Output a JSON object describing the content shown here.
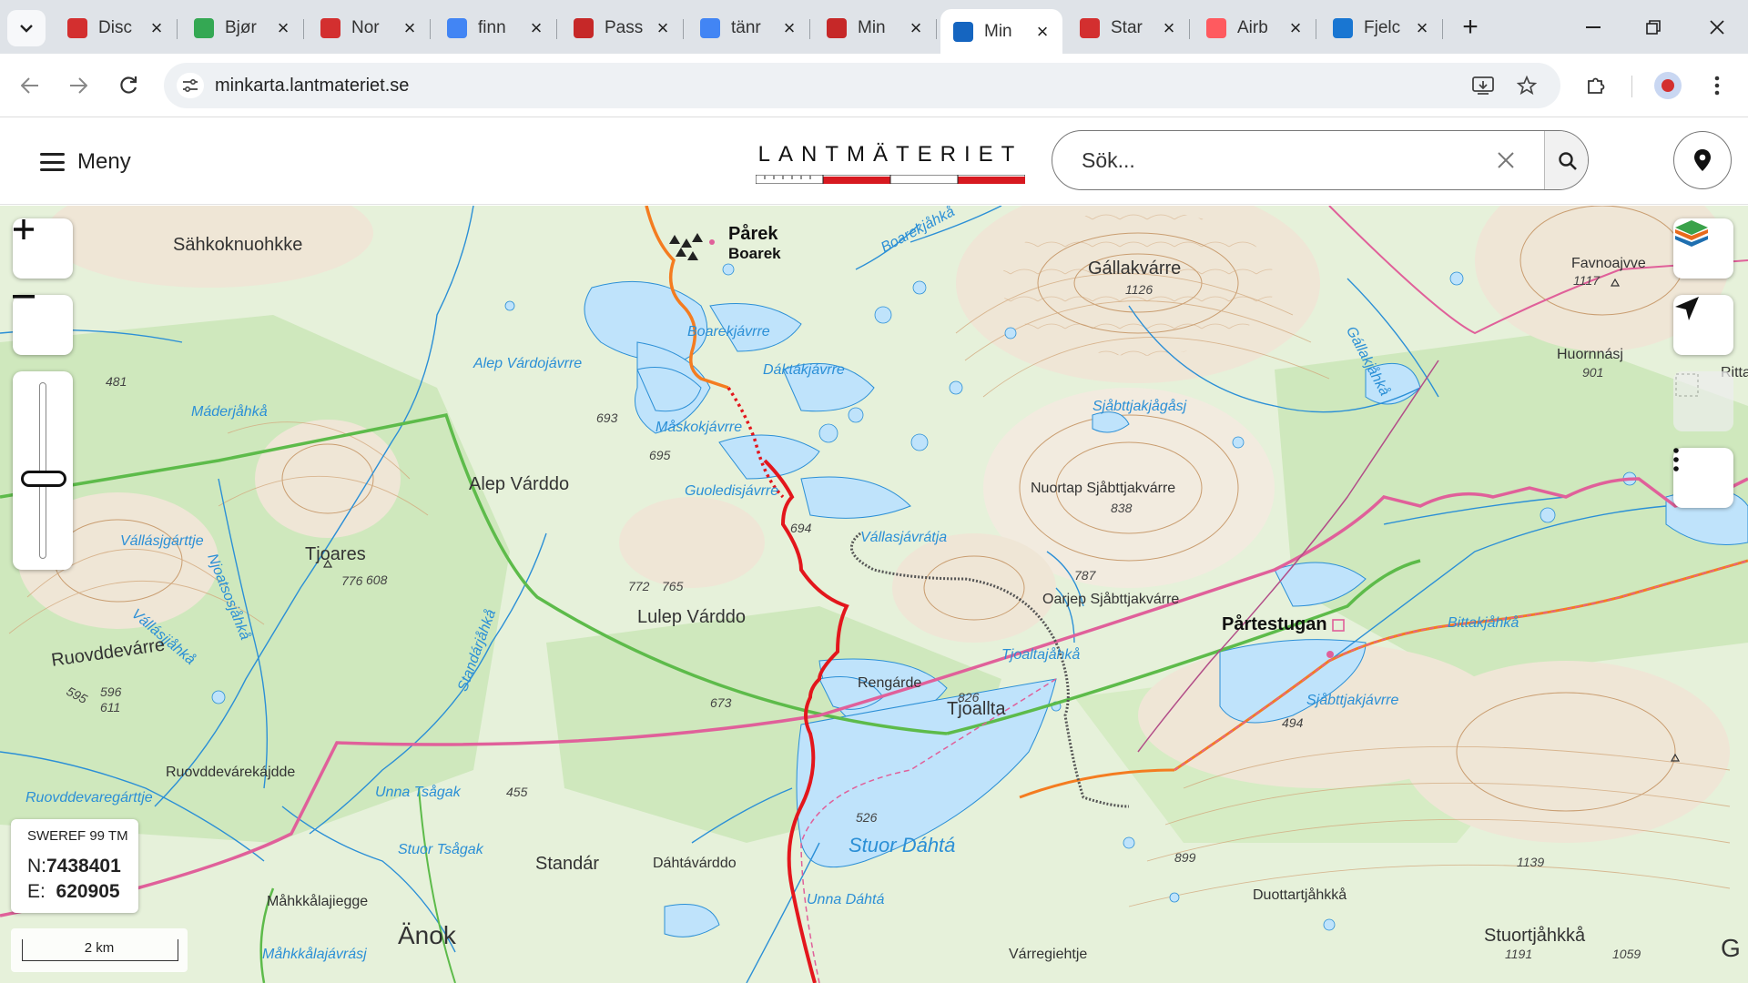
{
  "browser": {
    "tabs": [
      {
        "title": "Disc",
        "favicon": "heart-red",
        "color": "#d32f2f"
      },
      {
        "title": "Bjør",
        "favicon": "maps-pin",
        "color": "#34a853"
      },
      {
        "title": "Nor",
        "favicon": "flag-red",
        "color": "#d32f2f"
      },
      {
        "title": "finn",
        "favicon": "google-g",
        "color": "#4285f4"
      },
      {
        "title": "Pass",
        "favicon": "flame",
        "color": "#c62828"
      },
      {
        "title": "tänr",
        "favicon": "google-g",
        "color": "#4285f4"
      },
      {
        "title": "Min",
        "favicon": "flag-dk",
        "color": "#c62828"
      },
      {
        "title": "Min",
        "favicon": "location-pin",
        "color": "#1565c0"
      },
      {
        "title": "Star",
        "favicon": "shoe-red",
        "color": "#d32f2f"
      },
      {
        "title": "Airb",
        "favicon": "airbnb",
        "color": "#ff5a5f"
      },
      {
        "title": "Fjelc",
        "favicon": "mountain",
        "color": "#1976d2"
      }
    ],
    "active_tab_index": 7,
    "url": "minkarta.lantmateriet.se"
  },
  "header": {
    "menu_label": "Meny",
    "logo_text": "LANTMÄTERIET",
    "search_placeholder": "Sök..."
  },
  "map": {
    "coords": {
      "system": "SWEREF 99 TM",
      "n_label": "N:",
      "n_value": "7438401",
      "e_label": "E:",
      "e_value": "620905"
    },
    "scale_label": "2 km",
    "zoom_level": 0.45,
    "labels": [
      {
        "text": "Sähkoknuohkke",
        "style": "place"
      },
      {
        "text": "Pårek",
        "style": "settlement"
      },
      {
        "text": "Boarek",
        "style": "settlement-sub"
      },
      {
        "text": "Boarekjåhkå",
        "style": "water"
      },
      {
        "text": "Gállakvárre",
        "style": "place"
      },
      {
        "text": "1126",
        "style": "height"
      },
      {
        "text": "Favnoajvve",
        "style": "place-small"
      },
      {
        "text": "1117",
        "style": "height"
      },
      {
        "text": "Boarekjávrre",
        "style": "water"
      },
      {
        "text": "Alep Várdojávrre",
        "style": "water"
      },
      {
        "text": "Dáktákjávrre",
        "style": "water"
      },
      {
        "text": "Gállakjåhkå",
        "style": "water"
      },
      {
        "text": "Huornnásj",
        "style": "place-small"
      },
      {
        "text": "901",
        "style": "height"
      },
      {
        "text": "Ritta",
        "style": "place-small"
      },
      {
        "text": "481",
        "style": "height"
      },
      {
        "text": "Máderjåhkå",
        "style": "water"
      },
      {
        "text": "693",
        "style": "height"
      },
      {
        "text": "Måskokjávrre",
        "style": "water"
      },
      {
        "text": "Sjåbttjakjågåsj",
        "style": "water"
      },
      {
        "text": "695",
        "style": "height"
      },
      {
        "text": "Alep Várddo",
        "style": "place"
      },
      {
        "text": "Guoledisjávrre",
        "style": "water"
      },
      {
        "text": "Nuortap Sjåbttjakvárre",
        "style": "place-small"
      },
      {
        "text": "838",
        "style": "height"
      },
      {
        "text": "694",
        "style": "height"
      },
      {
        "text": "Vállasjávrátja",
        "style": "water"
      },
      {
        "text": "Vállásjgárttje",
        "style": "water"
      },
      {
        "text": "Tjoares",
        "style": "place"
      },
      {
        "text": "776",
        "style": "height"
      },
      {
        "text": "Njoatsosjåhkå",
        "style": "water"
      },
      {
        "text": "Vállásjjåhkå",
        "style": "water"
      },
      {
        "text": "608",
        "style": "height"
      },
      {
        "text": "772",
        "style": "height"
      },
      {
        "text": "765",
        "style": "height"
      },
      {
        "text": "787",
        "style": "height"
      },
      {
        "text": "Oarjep Sjåbttjakvárre",
        "style": "place-small"
      },
      {
        "text": "Lulep Várddo",
        "style": "place"
      },
      {
        "text": "Pårtestugan",
        "style": "settlement"
      },
      {
        "text": "Bittakjåhkå",
        "style": "water"
      },
      {
        "text": "Ruovddevárre",
        "style": "place"
      },
      {
        "text": "Rengárde",
        "style": "place-small"
      },
      {
        "text": "Tjoaltajåhkå",
        "style": "water"
      },
      {
        "text": "595",
        "style": "height"
      },
      {
        "text": "596",
        "style": "height"
      },
      {
        "text": "611",
        "style": "height"
      },
      {
        "text": "Standárjåhkå",
        "style": "water"
      },
      {
        "text": "826",
        "style": "height"
      },
      {
        "text": "Tjoallta",
        "style": "place"
      },
      {
        "text": "Sjåbttjakjávrre",
        "style": "water"
      },
      {
        "text": "673",
        "style": "height"
      },
      {
        "text": "494",
        "style": "height"
      },
      {
        "text": "Ruovddevárekájdde",
        "style": "place-small"
      },
      {
        "text": "Ruovddevaregárttje",
        "style": "water"
      },
      {
        "text": "Unna Tsågak",
        "style": "water"
      },
      {
        "text": "455",
        "style": "height"
      },
      {
        "text": "526",
        "style": "height"
      },
      {
        "text": "Stuor Dáhtá",
        "style": "water-big"
      },
      {
        "text": "Stuor Tsågak",
        "style": "water"
      },
      {
        "text": "Standár",
        "style": "place"
      },
      {
        "text": "Dáhtávárddo",
        "style": "place-small"
      },
      {
        "text": "899",
        "style": "height"
      },
      {
        "text": "1139",
        "style": "height"
      },
      {
        "text": "Unna Dáhtá",
        "style": "water"
      },
      {
        "text": "Duottartjåhkkå",
        "style": "place-small"
      },
      {
        "text": "Måhkkålajiegge",
        "style": "place-small"
      },
      {
        "text": "Änok",
        "style": "place-big"
      },
      {
        "text": "Måhkkålajávrásj",
        "style": "water"
      },
      {
        "text": "Várregiehtje",
        "style": "place-small"
      },
      {
        "text": "Stuortjåhkkå",
        "style": "place"
      },
      {
        "text": "1191",
        "style": "height"
      },
      {
        "text": "1059",
        "style": "height"
      },
      {
        "text": "G",
        "style": "place-big"
      }
    ]
  },
  "colors": {
    "route_red": "#e3161c",
    "route_orange": "#f47c20",
    "boundary_pink": "#e0609a",
    "boundary_green": "#5dbb4a",
    "water_blue": "#2b8fd6",
    "lake_fill": "#bfe3fb",
    "forest_green": "#cfe8bd",
    "brand_red": "#d71920"
  },
  "icons": {
    "zoom_in": "plus-icon",
    "zoom_out": "minus-icon",
    "layers": "layers-icon",
    "locate": "navigation-arrow-icon",
    "select_area": "select-area-icon",
    "more": "more-vertical-icon"
  }
}
